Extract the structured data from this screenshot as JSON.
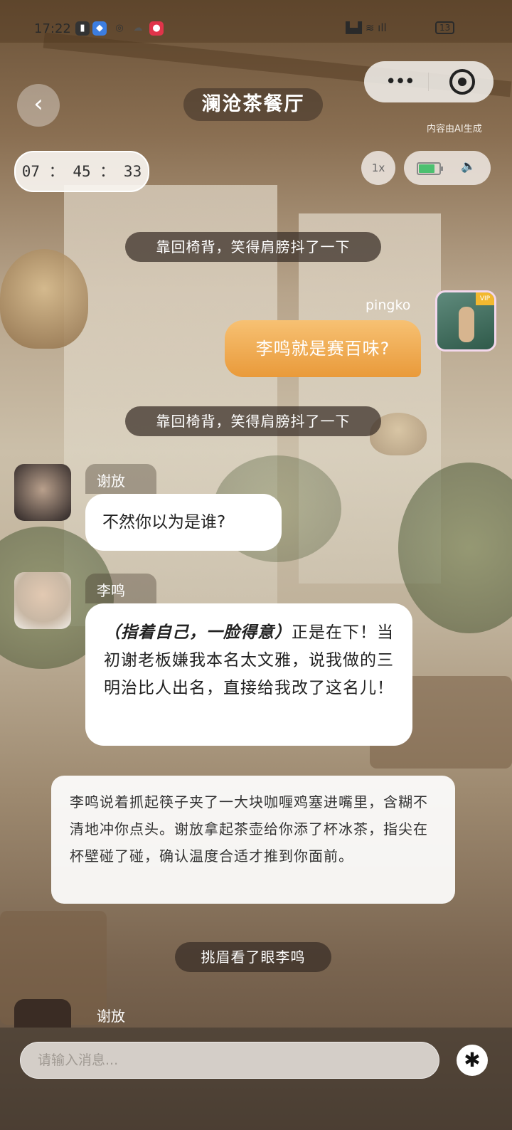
{
  "status_bar": {
    "time": "17:22",
    "battery_text": "13"
  },
  "header": {
    "back_icon": "chevron-left-icon",
    "title": "澜沧茶餐厅",
    "ai_note": "内容由AI生成"
  },
  "timer": "07 ： 45 ： 33",
  "playback": {
    "speed": "1x",
    "battery_level": 0.8,
    "volume_icon": "speaker-icon"
  },
  "messages": {
    "narr_1": "靠回椅背，笑得肩膀抖了一下",
    "user_name": "pingko",
    "user_text": "李鸣就是赛百味?",
    "narr_2": "靠回椅背，笑得肩膀抖了一下",
    "xiefang_name": "谢放",
    "xiefang_text": "不然你以为是谁?",
    "liming_name": "李鸣",
    "liming_emph": "（指着自己，一脸得意）",
    "liming_text": "正是在下！当初谢老板嫌我本名太文雅，说我做的三明治比人出名，直接给我改了这名儿！",
    "description": "李鸣说着抓起筷子夹了一大块咖喱鸡塞进嘴里，含糊不清地冲你点头。谢放拿起茶壶给你添了杯冰茶，指尖在杯壁碰了碰，确认温度合适才推到你面前。",
    "narr_3": "挑眉看了眼李鸣",
    "partial_name": "谢放"
  },
  "input": {
    "placeholder": "请输入消息..."
  },
  "colors": {
    "accent": "#e99a3a",
    "bubble": "#ffffff",
    "narration_bg": "#372d26"
  }
}
